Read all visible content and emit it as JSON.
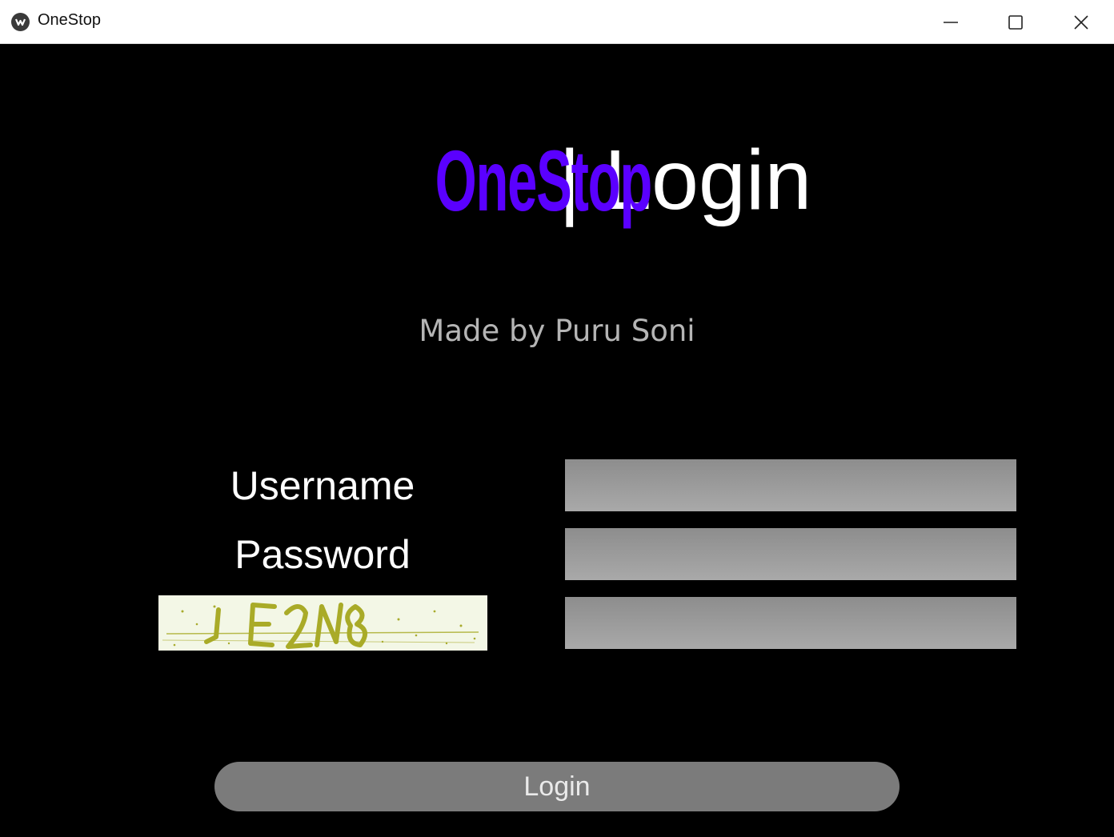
{
  "window": {
    "title": "OneStop",
    "controls": {
      "minimize_icon": "minimize-icon",
      "maximize_icon": "maximize-icon",
      "close_icon": "close-icon"
    }
  },
  "heading": {
    "brand": "OneStop",
    "rest": " | Login",
    "brand_color": "#5a00ff"
  },
  "credit": "Made by Puru Soni",
  "form": {
    "username_label": "Username",
    "password_label": "Password",
    "username_value": "",
    "password_value": "",
    "captcha_value": "",
    "captcha_image_text": "JGE2N8"
  },
  "login_button": "Login"
}
